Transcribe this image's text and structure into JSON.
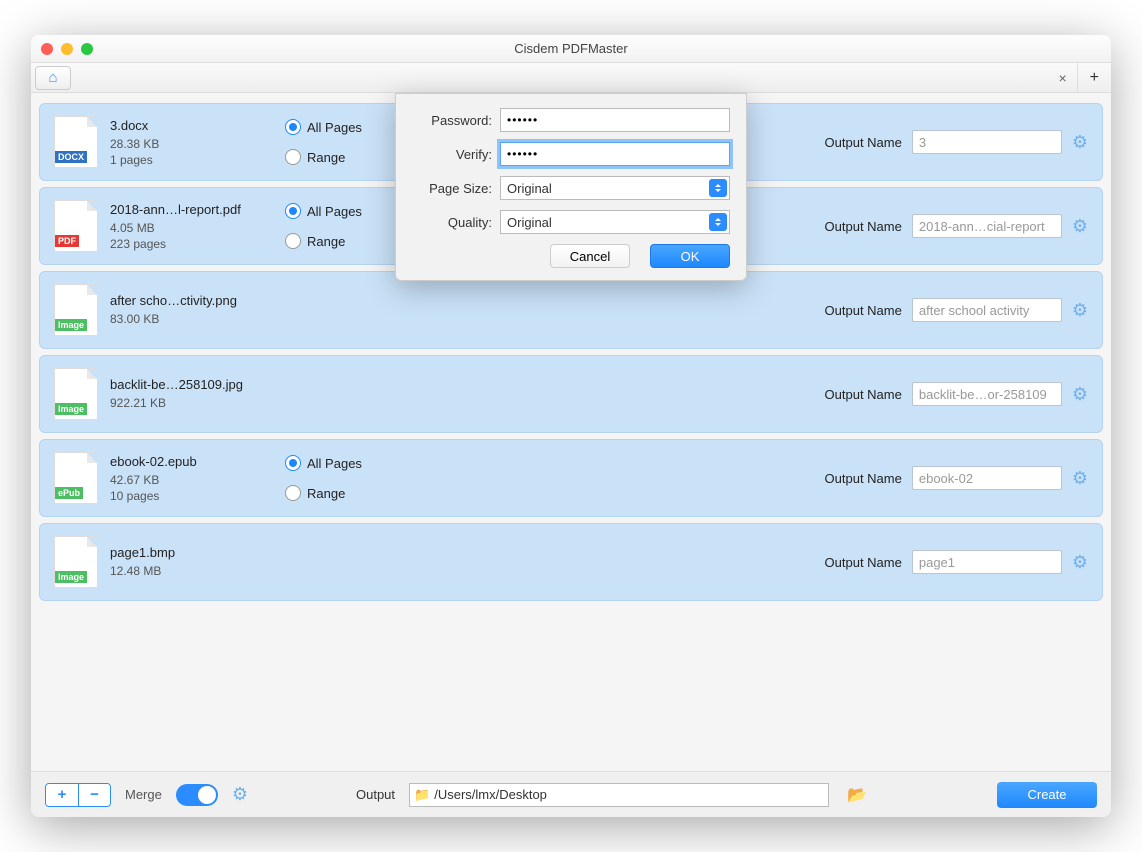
{
  "title": "Cisdem PDFMaster",
  "labels": {
    "allPages": "All Pages",
    "range": "Range",
    "outputName": "Output Name",
    "merge": "Merge",
    "output": "Output",
    "create": "Create"
  },
  "outputPath": "/Users/lmx/Desktop",
  "files": [
    {
      "name": "3.docx",
      "size": "28.38 KB",
      "pages": "1 pages",
      "type": "docx",
      "hasRadios": true,
      "out": "3"
    },
    {
      "name": "2018-ann…l-report.pdf",
      "size": "4.05 MB",
      "pages": "223 pages",
      "type": "pdf",
      "hasRadios": true,
      "out": "2018-ann…cial-report"
    },
    {
      "name": "after scho…ctivity.png",
      "size": "83.00 KB",
      "pages": "",
      "type": "img",
      "hasRadios": false,
      "out": "after school activity"
    },
    {
      "name": "backlit-be…258109.jpg",
      "size": "922.21 KB",
      "pages": "",
      "type": "img",
      "hasRadios": false,
      "out": "backlit-be…or-258109"
    },
    {
      "name": "ebook-02.epub",
      "size": "42.67 KB",
      "pages": "10 pages",
      "type": "epub",
      "hasRadios": true,
      "out": "ebook-02"
    },
    {
      "name": "page1.bmp",
      "size": "12.48 MB",
      "pages": "",
      "type": "img",
      "hasRadios": false,
      "out": "page1"
    }
  ],
  "dialog": {
    "passwordLabel": "Password:",
    "verifyLabel": "Verify:",
    "pageSizeLabel": "Page Size:",
    "qualityLabel": "Quality:",
    "passwordValue": "••••••",
    "verifyValue": "••••••",
    "pageSizeValue": "Original",
    "qualityValue": "Original",
    "cancel": "Cancel",
    "ok": "OK"
  },
  "badges": {
    "docx": "DOCX",
    "pdf": "PDF",
    "img": "Image",
    "epub": "ePub"
  }
}
